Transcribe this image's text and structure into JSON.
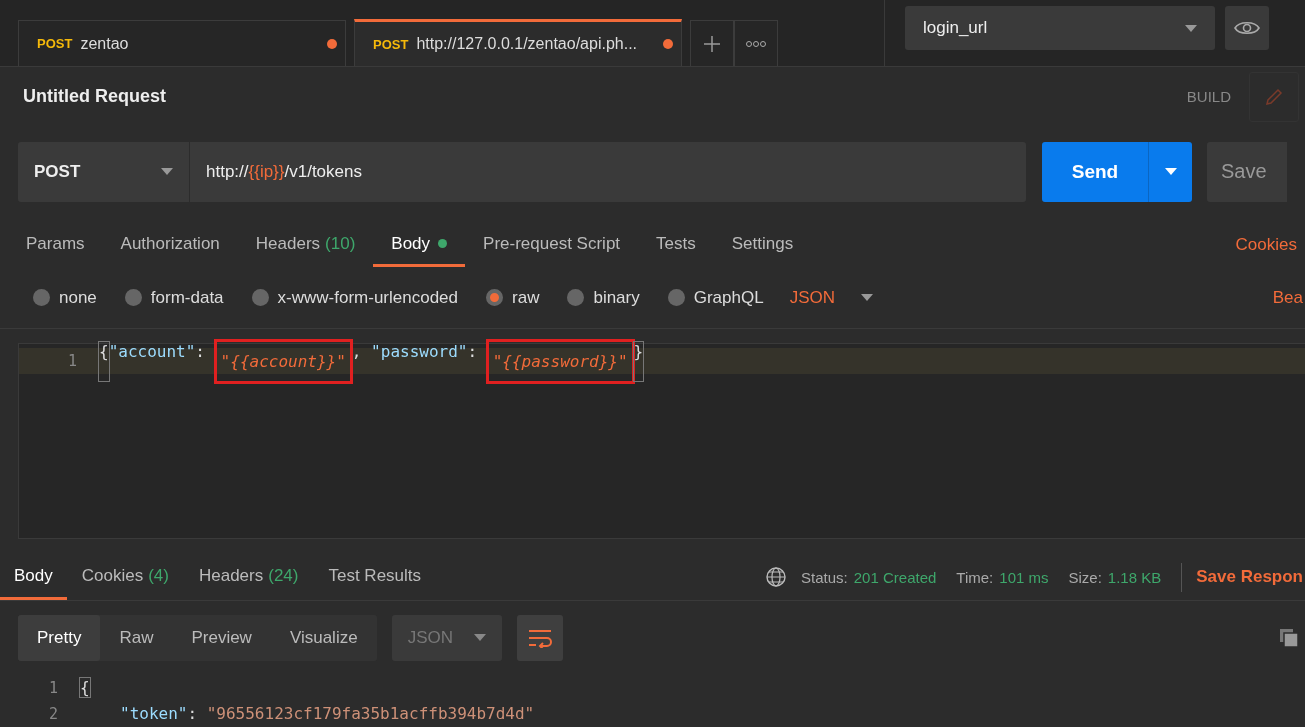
{
  "tabs": [
    {
      "method": "POST",
      "label": "zentao",
      "selected": false,
      "unsaved": true
    },
    {
      "method": "POST",
      "label": "http://127.0.0.1/zentao/api.ph...",
      "selected": true,
      "unsaved": true
    }
  ],
  "environment": {
    "value": "login_url"
  },
  "request": {
    "title": "Untitled Request",
    "build_label": "BUILD",
    "method": "POST",
    "url": [
      {
        "text": "http://",
        "kind": "plain"
      },
      {
        "text": "{{ip}}",
        "kind": "var"
      },
      {
        "text": "/v1/tokens",
        "kind": "plain"
      }
    ],
    "send": "Send",
    "save": "Save"
  },
  "request_tabs": [
    {
      "label": "Params",
      "selected": false,
      "dot": false
    },
    {
      "label": "Authorization",
      "selected": false,
      "dot": false
    },
    {
      "label": "Headers",
      "count": "(10)",
      "selected": false,
      "dot": false
    },
    {
      "label": "Body",
      "selected": true,
      "dot": true
    },
    {
      "label": "Pre-request Script",
      "selected": false,
      "dot": false
    },
    {
      "label": "Tests",
      "selected": false,
      "dot": false
    },
    {
      "label": "Settings",
      "selected": false,
      "dot": false
    }
  ],
  "cookies_link": "Cookies",
  "body_types": [
    {
      "label": "none",
      "selected": false
    },
    {
      "label": "form-data",
      "selected": false
    },
    {
      "label": "x-www-form-urlencoded",
      "selected": false
    },
    {
      "label": "raw",
      "selected": true
    },
    {
      "label": "binary",
      "selected": false
    },
    {
      "label": "GraphQL",
      "selected": false
    }
  ],
  "raw_format": "JSON",
  "beautify_link": "Bea",
  "editor": {
    "lines": [
      {
        "number": "1",
        "segments": [
          {
            "text": "{",
            "kind": "bracket"
          },
          {
            "text": "\"account\"",
            "kind": "key"
          },
          {
            "text": ": ",
            "kind": "punct"
          },
          {
            "text": "\"{{account}}\"",
            "kind": "var",
            "boxed": true
          },
          {
            "text": ", ",
            "kind": "punct"
          },
          {
            "text": "\"password\"",
            "kind": "key"
          },
          {
            "text": ": ",
            "kind": "punct"
          },
          {
            "text": "\"{{password}}\"",
            "kind": "var",
            "boxed": true
          },
          {
            "text": "}",
            "kind": "bracket"
          }
        ]
      }
    ]
  },
  "response": {
    "tabs": [
      {
        "label": "Body",
        "selected": true
      },
      {
        "label": "Cookies",
        "count": "(4)",
        "selected": false
      },
      {
        "label": "Headers",
        "count": "(24)",
        "selected": false
      },
      {
        "label": "Test Results",
        "selected": false
      }
    ],
    "status_label": "Status:",
    "status": "201 Created",
    "time_label": "Time:",
    "time": "101 ms",
    "size_label": "Size:",
    "size": "1.18 KB",
    "save_link": "Save Respon",
    "views": [
      {
        "label": "Pretty",
        "selected": true
      },
      {
        "label": "Raw",
        "selected": false
      },
      {
        "label": "Preview",
        "selected": false
      },
      {
        "label": "Visualize",
        "selected": false
      }
    ],
    "format": "JSON",
    "lines": [
      {
        "number": "1",
        "segments": [
          {
            "text": "{",
            "kind": "bracket"
          }
        ],
        "children": [
          {
            "number": "2",
            "segments": [
              {
                "text": "\"token\"",
                "kind": "key"
              },
              {
                "text": ": ",
                "kind": "punct"
              },
              {
                "text": "\"96556123cf179fa35b1acffb394b7d4d\"",
                "kind": "string"
              }
            ]
          }
        ]
      }
    ]
  }
}
